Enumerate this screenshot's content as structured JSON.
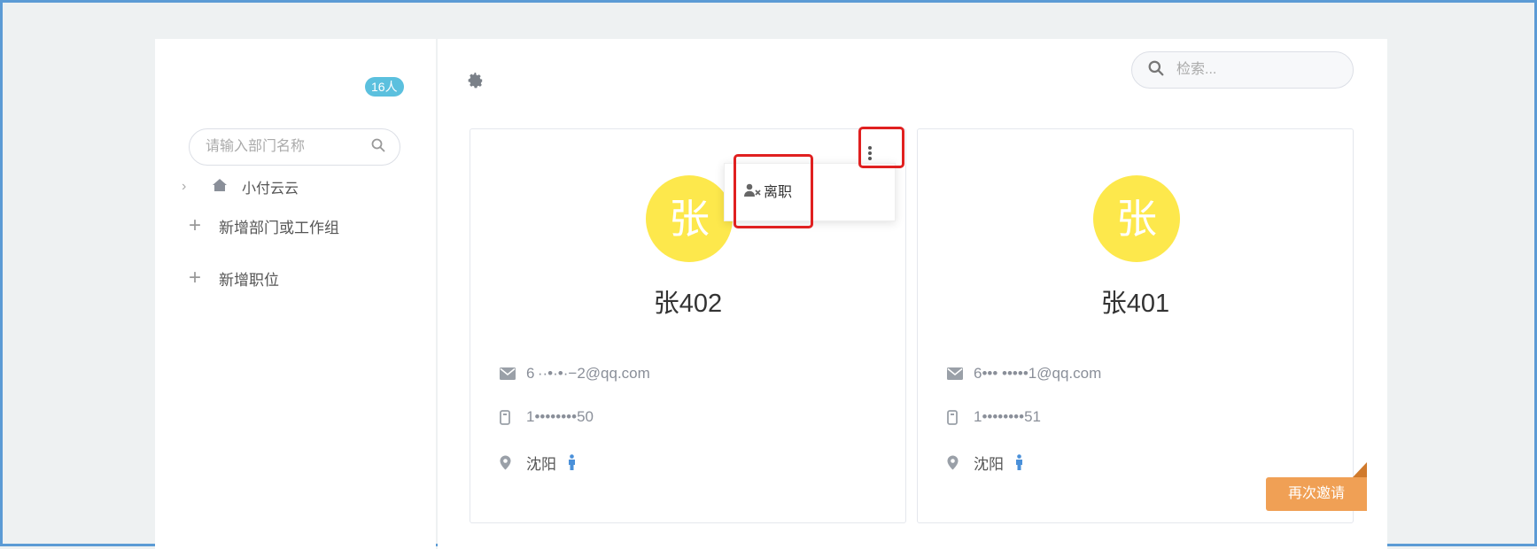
{
  "sidebar": {
    "member_count": "16人",
    "dept_search_placeholder": "请输入部门名称",
    "tree": [
      {
        "label": "小付云云",
        "icon": "home-icon",
        "collapsed": true
      }
    ],
    "actions": [
      {
        "label": "新增部门或工作组",
        "icon": "plus-icon"
      },
      {
        "label": "新增职位",
        "icon": "plus-icon"
      }
    ]
  },
  "main": {
    "search_placeholder": "检索...",
    "members": [
      {
        "avatar_char": "张",
        "name": "张402",
        "email": "6 ··•·•·−2@qq.com",
        "phone": "1••••••••50",
        "city": "沈阳",
        "gender_icon": "male-person-icon",
        "menu_open": true
      },
      {
        "avatar_char": "张",
        "name": "张401",
        "email": "6••• •••••1@qq.com",
        "phone": "1••••••••51",
        "city": "沈阳",
        "gender_icon": "male-person-icon",
        "menu_open": false,
        "badge": "再次邀请"
      }
    ],
    "dropdown": {
      "items": [
        {
          "label": "离职",
          "icon": "user-remove-icon"
        }
      ]
    }
  },
  "colors": {
    "avatar": "#fde84c",
    "badge": "#5bc0de",
    "reinvite": "#f0a055",
    "highlight": "#e02020",
    "gender": "#4a90d9"
  }
}
